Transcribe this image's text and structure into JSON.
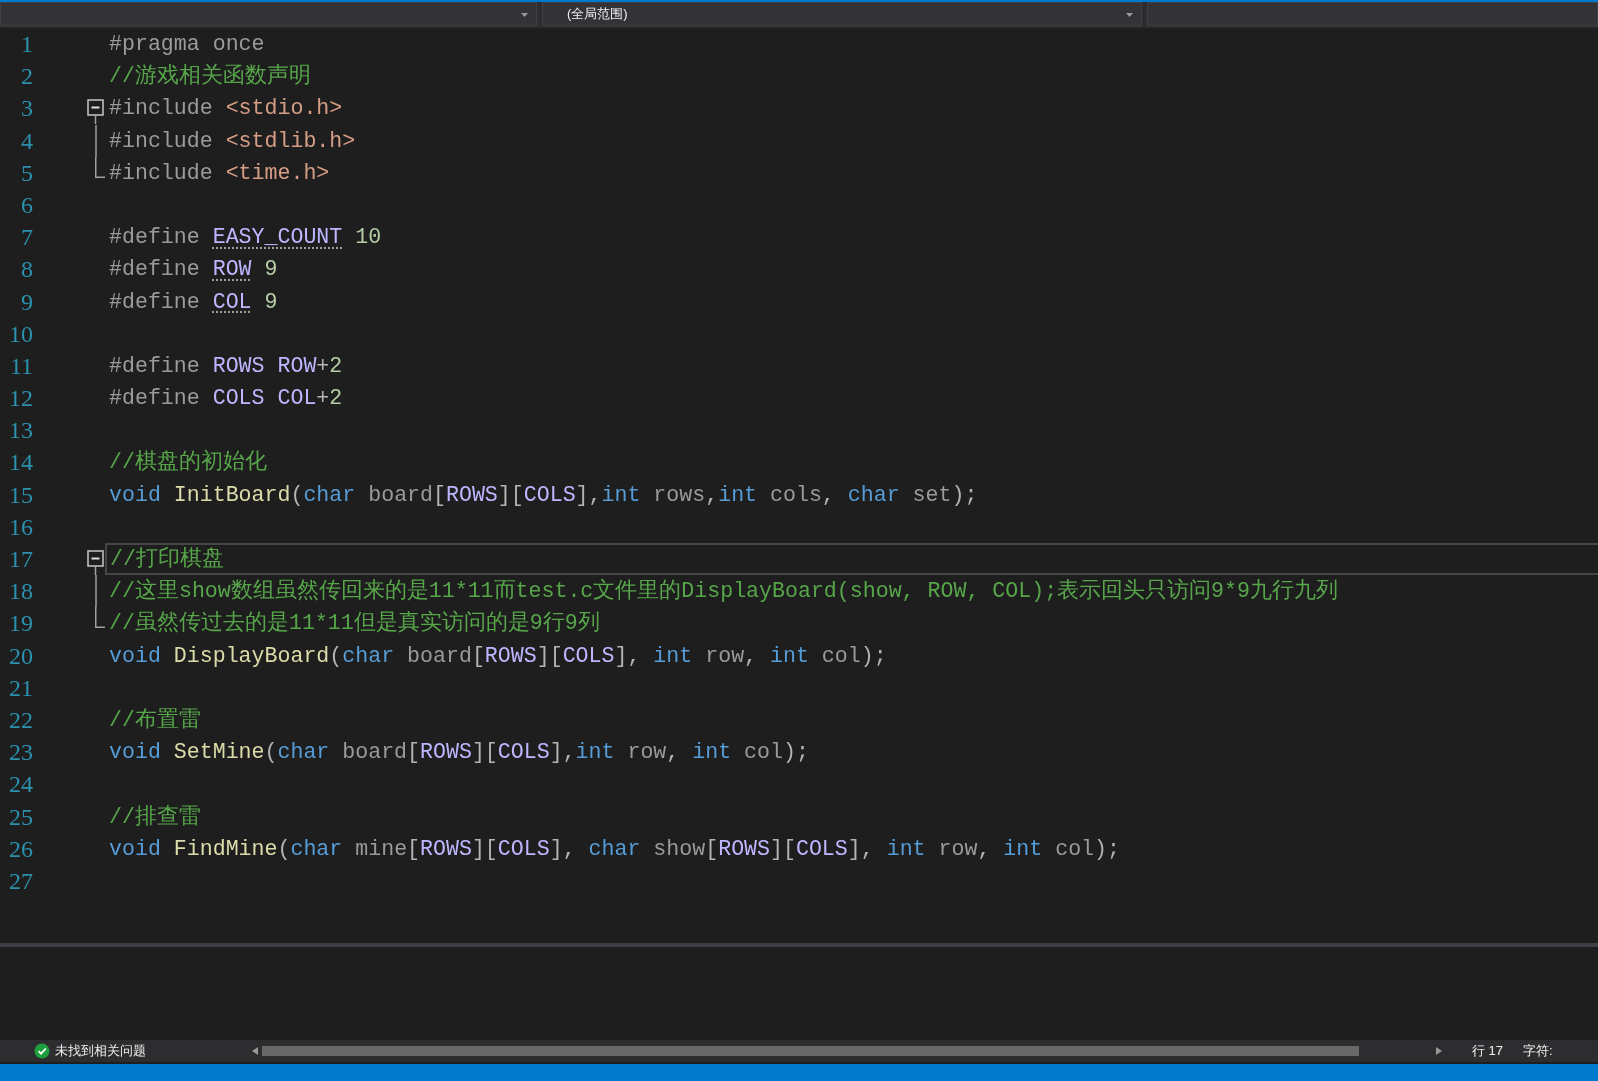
{
  "navigation_bar": {
    "scope": "(全局范围)"
  },
  "editor": {
    "lines": [
      {
        "number": "1",
        "current": false,
        "collapse_button": false,
        "fold_guide": false,
        "tokens": [
          {
            "kind": "preprocessor",
            "text": "#pragma once"
          }
        ]
      },
      {
        "number": "2",
        "current": false,
        "collapse_button": false,
        "fold_guide": false,
        "tokens": [
          {
            "kind": "comment",
            "text": "//游戏相关函数声明"
          }
        ]
      },
      {
        "number": "3",
        "current": false,
        "collapse_button": true,
        "fold_guide": false,
        "tokens": [
          {
            "kind": "preprocessor",
            "text": "#include "
          },
          {
            "kind": "header",
            "text": "<stdio.h>"
          }
        ]
      },
      {
        "number": "4",
        "current": false,
        "collapse_button": false,
        "fold_guide": true,
        "tokens": [
          {
            "kind": "preprocessor",
            "text": "#include "
          },
          {
            "kind": "header",
            "text": "<stdlib.h>"
          }
        ]
      },
      {
        "number": "5",
        "current": false,
        "collapse_button": false,
        "fold_guide": true,
        "tokens": [
          {
            "kind": "preprocessor",
            "text": "#include "
          },
          {
            "kind": "header",
            "text": "<time.h>"
          }
        ]
      },
      {
        "number": "6",
        "current": false,
        "collapse_button": false,
        "fold_guide": false
      },
      {
        "number": "7",
        "current": false,
        "collapse_button": false,
        "fold_guide": false,
        "tokens": [
          {
            "kind": "preprocessor",
            "text": "#define "
          },
          {
            "kind": "macro_hint",
            "text": "EASY_COUNT"
          },
          {
            "kind": "number",
            "text": " 10"
          }
        ]
      },
      {
        "number": "8",
        "current": false,
        "collapse_button": false,
        "fold_guide": false,
        "tokens": [
          {
            "kind": "preprocessor",
            "text": "#define "
          },
          {
            "kind": "macro_hint",
            "text": "ROW"
          },
          {
            "kind": "number",
            "text": " 9"
          }
        ]
      },
      {
        "number": "9",
        "current": false,
        "collapse_button": false,
        "fold_guide": false,
        "tokens": [
          {
            "kind": "preprocessor",
            "text": "#define "
          },
          {
            "kind": "macro_hint",
            "text": "COL"
          },
          {
            "kind": "number",
            "text": " 9"
          }
        ]
      },
      {
        "number": "10",
        "current": false,
        "collapse_button": false,
        "fold_guide": false
      },
      {
        "number": "11",
        "current": false,
        "collapse_button": false,
        "fold_guide": false,
        "tokens": [
          {
            "kind": "preprocessor",
            "text": "#define "
          },
          {
            "kind": "macro",
            "text": "ROWS ROW"
          },
          {
            "kind": "punct",
            "text": "+"
          },
          {
            "kind": "number",
            "text": "2"
          }
        ]
      },
      {
        "number": "12",
        "current": false,
        "collapse_button": false,
        "fold_guide": false,
        "tokens": [
          {
            "kind": "preprocessor",
            "text": "#define "
          },
          {
            "kind": "macro",
            "text": "COLS COL"
          },
          {
            "kind": "punct",
            "text": "+"
          },
          {
            "kind": "number",
            "text": "2"
          }
        ]
      },
      {
        "number": "13",
        "current": false,
        "collapse_button": false,
        "fold_guide": false
      },
      {
        "number": "14",
        "current": false,
        "collapse_button": false,
        "fold_guide": false,
        "tokens": [
          {
            "kind": "comment",
            "text": "//棋盘的初始化"
          }
        ]
      },
      {
        "number": "15",
        "current": false,
        "collapse_button": false,
        "fold_guide": false,
        "tokens": [
          {
            "kind": "keyword",
            "text": "void"
          },
          {
            "kind": "function",
            "text": " InitBoard"
          },
          {
            "kind": "punct",
            "text": "("
          },
          {
            "kind": "keyword",
            "text": "char"
          },
          {
            "kind": "param",
            "text": " board"
          },
          {
            "kind": "punct",
            "text": "["
          },
          {
            "kind": "macro",
            "text": "ROWS"
          },
          {
            "kind": "punct",
            "text": "]["
          },
          {
            "kind": "macro",
            "text": "COLS"
          },
          {
            "kind": "punct",
            "text": "],"
          },
          {
            "kind": "keyword",
            "text": "int"
          },
          {
            "kind": "param",
            "text": " rows"
          },
          {
            "kind": "punct",
            "text": ","
          },
          {
            "kind": "keyword",
            "text": "int"
          },
          {
            "kind": "param",
            "text": " cols"
          },
          {
            "kind": "punct",
            "text": ", "
          },
          {
            "kind": "keyword",
            "text": "char"
          },
          {
            "kind": "param",
            "text": " set"
          },
          {
            "kind": "punct",
            "text": ");"
          }
        ]
      },
      {
        "number": "16",
        "current": false,
        "collapse_button": false,
        "fold_guide": false
      },
      {
        "number": "17",
        "current": true,
        "collapse_button": true,
        "fold_guide": false,
        "tokens": [
          {
            "kind": "comment",
            "text": "//打印棋盘"
          }
        ]
      },
      {
        "number": "18",
        "current": false,
        "collapse_button": false,
        "fold_guide": true,
        "tokens": [
          {
            "kind": "comment",
            "text": "//这里show数组虽然传回来的是11*11而test.c文件里的DisplayBoard(show, ROW, COL);表示回头只访问9*9九行九列"
          }
        ]
      },
      {
        "number": "19",
        "current": false,
        "collapse_button": false,
        "fold_guide": true,
        "tokens": [
          {
            "kind": "comment",
            "text": "//虽然传过去的是11*11但是真实访问的是9行9列"
          }
        ]
      },
      {
        "number": "20",
        "current": false,
        "collapse_button": false,
        "fold_guide": false,
        "tokens": [
          {
            "kind": "keyword",
            "text": "void"
          },
          {
            "kind": "function",
            "text": " DisplayBoard"
          },
          {
            "kind": "punct",
            "text": "("
          },
          {
            "kind": "keyword",
            "text": "char"
          },
          {
            "kind": "param",
            "text": " board"
          },
          {
            "kind": "punct",
            "text": "["
          },
          {
            "kind": "macro",
            "text": "ROWS"
          },
          {
            "kind": "punct",
            "text": "]["
          },
          {
            "kind": "macro",
            "text": "COLS"
          },
          {
            "kind": "punct",
            "text": "], "
          },
          {
            "kind": "keyword",
            "text": "int"
          },
          {
            "kind": "param",
            "text": " row"
          },
          {
            "kind": "punct",
            "text": ", "
          },
          {
            "kind": "keyword",
            "text": "int"
          },
          {
            "kind": "param",
            "text": " col"
          },
          {
            "kind": "punct",
            "text": ");"
          }
        ]
      },
      {
        "number": "21",
        "current": false,
        "collapse_button": false,
        "fold_guide": false
      },
      {
        "number": "22",
        "current": false,
        "collapse_button": false,
        "fold_guide": false,
        "tokens": [
          {
            "kind": "comment",
            "text": "//布置雷"
          }
        ]
      },
      {
        "number": "23",
        "current": false,
        "collapse_button": false,
        "fold_guide": false,
        "tokens": [
          {
            "kind": "keyword",
            "text": "void"
          },
          {
            "kind": "function",
            "text": " SetMine"
          },
          {
            "kind": "punct",
            "text": "("
          },
          {
            "kind": "keyword",
            "text": "char"
          },
          {
            "kind": "param",
            "text": " board"
          },
          {
            "kind": "punct",
            "text": "["
          },
          {
            "kind": "macro",
            "text": "ROWS"
          },
          {
            "kind": "punct",
            "text": "]["
          },
          {
            "kind": "macro",
            "text": "COLS"
          },
          {
            "kind": "punct",
            "text": "],"
          },
          {
            "kind": "keyword",
            "text": "int"
          },
          {
            "kind": "param",
            "text": " row"
          },
          {
            "kind": "punct",
            "text": ", "
          },
          {
            "kind": "keyword",
            "text": "int"
          },
          {
            "kind": "param",
            "text": " col"
          },
          {
            "kind": "punct",
            "text": ");"
          }
        ]
      },
      {
        "number": "24",
        "current": false,
        "collapse_button": false,
        "fold_guide": false
      },
      {
        "number": "25",
        "current": false,
        "collapse_button": false,
        "fold_guide": false,
        "tokens": [
          {
            "kind": "comment",
            "text": "//排查雷"
          }
        ]
      },
      {
        "number": "26",
        "current": false,
        "collapse_button": false,
        "fold_guide": false,
        "tokens": [
          {
            "kind": "keyword",
            "text": "void"
          },
          {
            "kind": "function",
            "text": " FindMine"
          },
          {
            "kind": "punct",
            "text": "("
          },
          {
            "kind": "keyword",
            "text": "char"
          },
          {
            "kind": "param",
            "text": " mine"
          },
          {
            "kind": "punct",
            "text": "["
          },
          {
            "kind": "macro",
            "text": "ROWS"
          },
          {
            "kind": "punct",
            "text": "]["
          },
          {
            "kind": "macro",
            "text": "COLS"
          },
          {
            "kind": "punct",
            "text": "], "
          },
          {
            "kind": "keyword",
            "text": "char"
          },
          {
            "kind": "param",
            "text": " show"
          },
          {
            "kind": "punct",
            "text": "["
          },
          {
            "kind": "macro",
            "text": "ROWS"
          },
          {
            "kind": "punct",
            "text": "]["
          },
          {
            "kind": "macro",
            "text": "COLS"
          },
          {
            "kind": "punct",
            "text": "], "
          },
          {
            "kind": "keyword",
            "text": "int"
          },
          {
            "kind": "param",
            "text": " row"
          },
          {
            "kind": "punct",
            "text": ", "
          },
          {
            "kind": "keyword",
            "text": "int"
          },
          {
            "kind": "param",
            "text": " col"
          },
          {
            "kind": "punct",
            "text": ");"
          }
        ]
      },
      {
        "number": "27",
        "current": false,
        "collapse_button": false,
        "fold_guide": false
      }
    ]
  },
  "status_bar": {
    "issues": "未找到相关问题",
    "line": "行 17",
    "column": "字符:"
  }
}
